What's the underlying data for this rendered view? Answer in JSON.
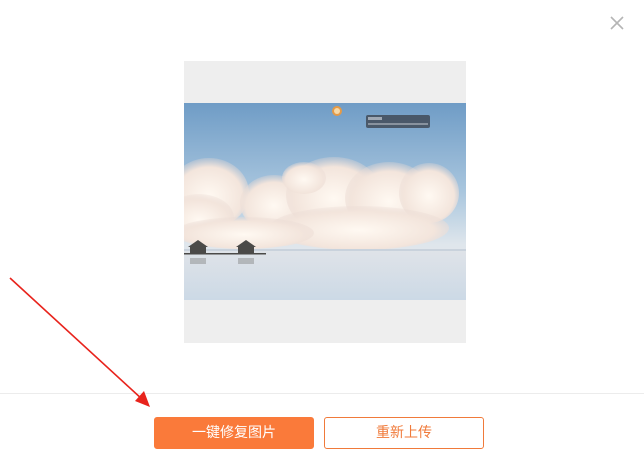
{
  "dialog": {
    "close_icon": "close-icon"
  },
  "preview": {
    "image_icon": "landscape-photo"
  },
  "actions": {
    "repair_label": "一键修复图片",
    "reupload_label": "重新上传"
  },
  "colors": {
    "accent": "#fa7a3a",
    "annotation_arrow": "#e8231c"
  }
}
